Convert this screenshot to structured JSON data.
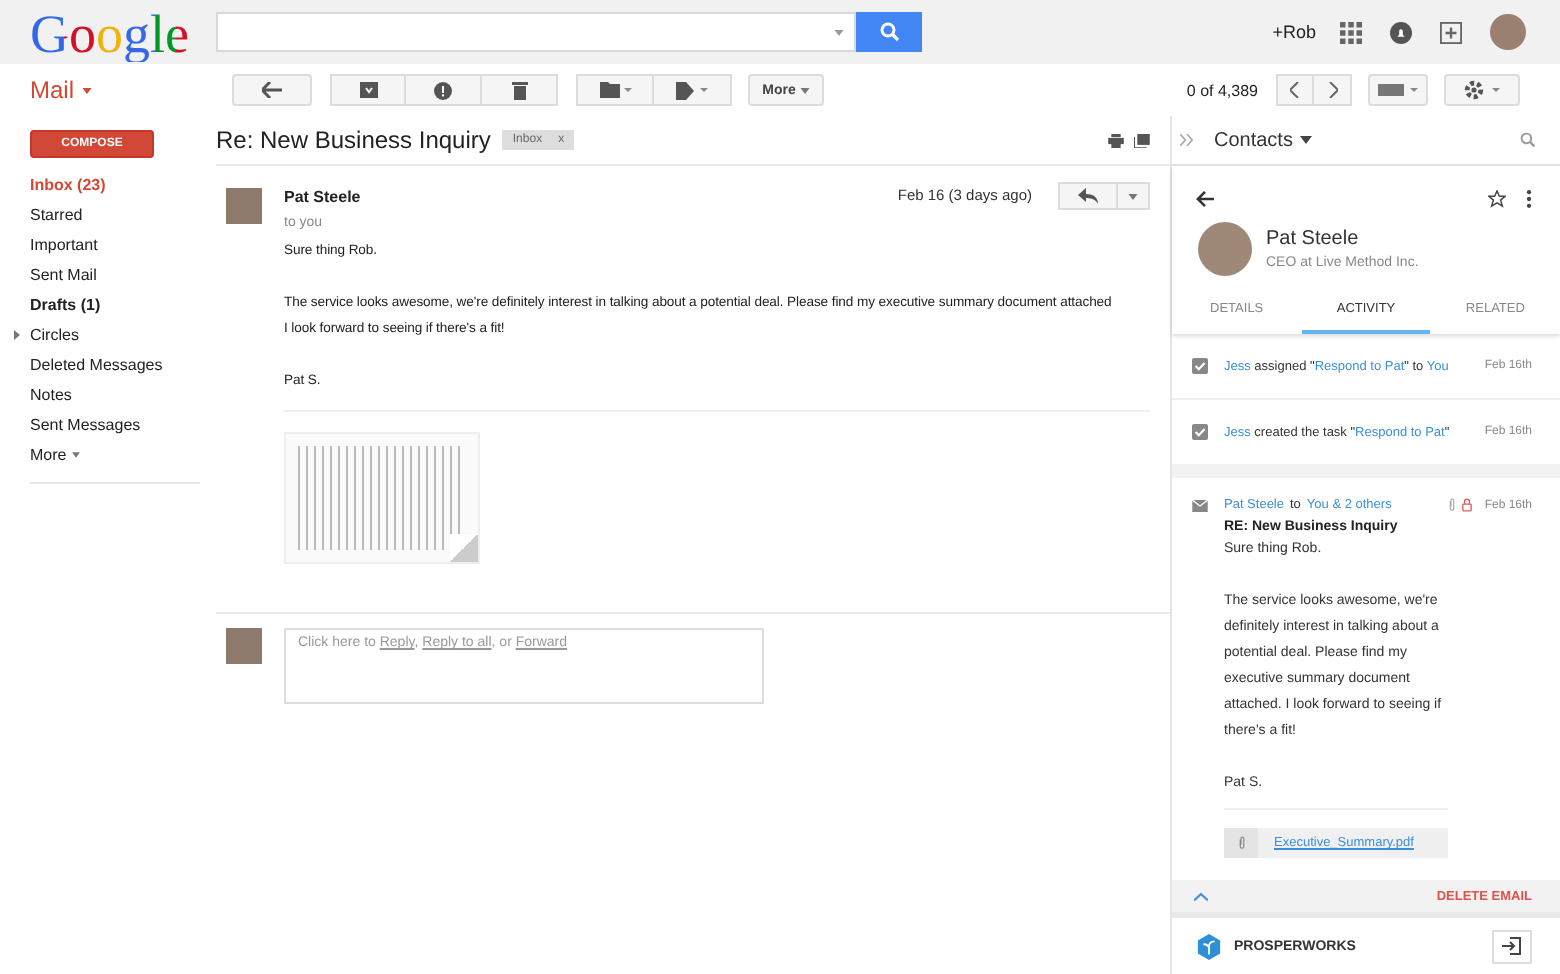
{
  "header": {
    "logo": "Google",
    "account": "+Rob"
  },
  "toolbar": {
    "app": "Mail",
    "more": "More",
    "count": "0 of 4,389"
  },
  "compose": "COMPOSE",
  "sidebar": {
    "items": [
      {
        "label": "Inbox (23)",
        "selected": true,
        "bold": true,
        "kind": "folder"
      },
      {
        "label": "Starred",
        "selected": false,
        "bold": false,
        "kind": "folder"
      },
      {
        "label": "Important",
        "selected": false,
        "bold": false,
        "kind": "folder"
      },
      {
        "label": "Sent Mail",
        "selected": false,
        "bold": false,
        "kind": "folder"
      },
      {
        "label": "Drafts (1)",
        "selected": false,
        "bold": true,
        "kind": "folder"
      },
      {
        "label": "Circles",
        "selected": false,
        "bold": false,
        "kind": "group"
      },
      {
        "label": "Deleted Messages",
        "selected": false,
        "bold": false,
        "kind": "folder"
      },
      {
        "label": "Notes",
        "selected": false,
        "bold": false,
        "kind": "folder"
      },
      {
        "label": "Sent Messages",
        "selected": false,
        "bold": false,
        "kind": "folder"
      },
      {
        "label": "More",
        "selected": false,
        "bold": false,
        "kind": "more"
      }
    ]
  },
  "thread": {
    "subject": "Re: New Business Inquiry",
    "label": "Inbox",
    "label_close": "x",
    "message": {
      "sender": "Pat Steele",
      "to": "to you",
      "date": "Feb 16 (3 days ago)",
      "paragraphs": [
        [
          "Sure thing Rob."
        ],
        [
          "The service looks awesome, we're definitely interest in talking about a potential deal. Please find my executive summary document attached",
          "I look forward to seeing if there's a fit!"
        ],
        [
          "Pat S."
        ]
      ]
    },
    "reply": [
      {
        "kind": "text",
        "text": "Click here to "
      },
      {
        "kind": "link",
        "text": "Reply"
      },
      {
        "kind": "text",
        "text": ", "
      },
      {
        "kind": "link",
        "text": "Reply to all"
      },
      {
        "kind": "text",
        "text": ", or "
      },
      {
        "kind": "link",
        "text": "Forward"
      }
    ]
  },
  "contacts": {
    "title": "Contacts",
    "name": "Pat Steele",
    "subtitle": "CEO at Live Method Inc.",
    "tabs": [
      {
        "label": "DETAILS",
        "selected": false
      },
      {
        "label": "ACTIVITY",
        "selected": true
      },
      {
        "label": "RELATED",
        "selected": false
      }
    ],
    "activities": [
      {
        "parts": [
          {
            "kind": "link",
            "text": "Jess"
          },
          {
            "kind": "text",
            "text": " assigned \""
          },
          {
            "kind": "link",
            "text": "Respond to Pat"
          },
          {
            "kind": "text",
            "text": "\" to "
          },
          {
            "kind": "link",
            "text": "You"
          }
        ],
        "date": "Feb 16th"
      },
      {
        "parts": [
          {
            "kind": "link",
            "text": "Jess"
          },
          {
            "kind": "text",
            "text": " created the task \""
          },
          {
            "kind": "link",
            "text": "Respond to Pat"
          },
          {
            "kind": "text",
            "text": "\""
          }
        ],
        "date": "Feb 16th"
      }
    ],
    "email": {
      "from": "Pat Steele",
      "to_word": "to",
      "recipients": "You & 2 others",
      "date": "Feb 16th",
      "subject": "RE: New Business Inquiry",
      "paragraphs": [
        "Sure thing Rob.",
        "The service looks awesome, we're definitely interest in talking about a potential deal. Please find my executive summary document attached. I look forward to seeing if there's a fit!",
        "Pat S."
      ],
      "attachment": "Executive_Summary.pdf"
    },
    "delete": "DELETE EMAIL",
    "brand": "PROSPERWORKS"
  }
}
